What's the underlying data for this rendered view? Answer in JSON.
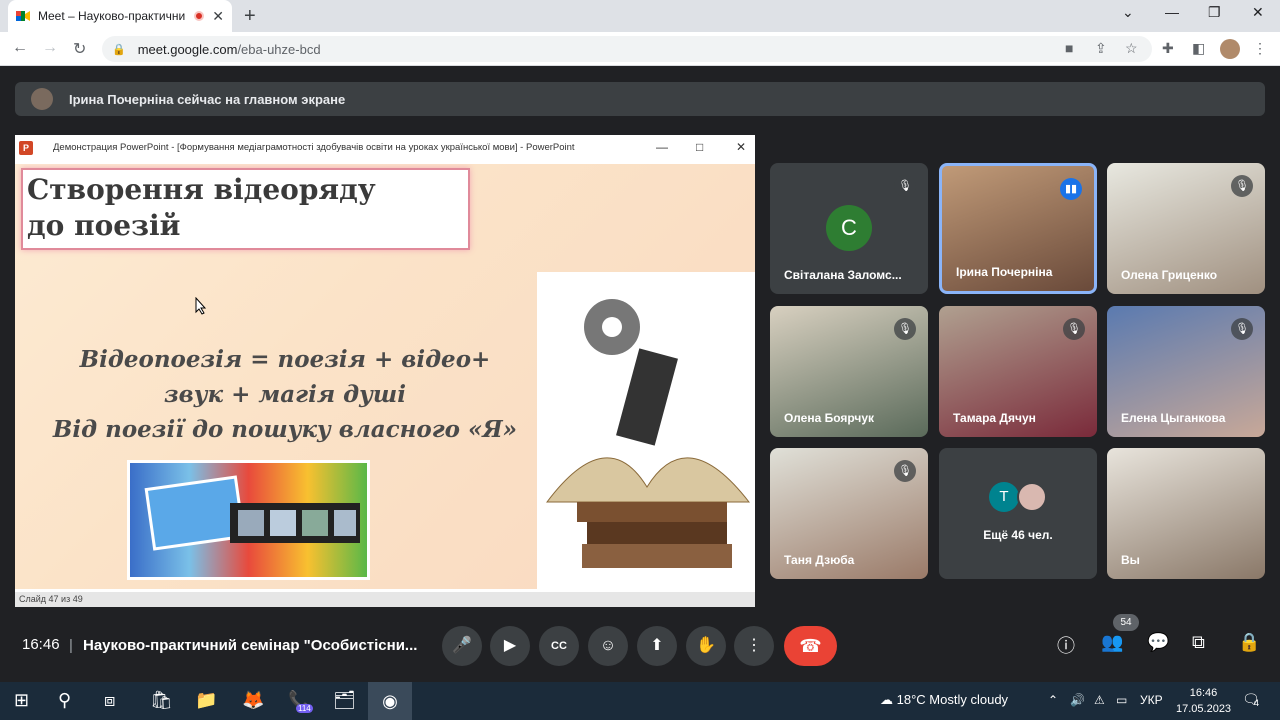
{
  "browser": {
    "tab_title": "Meet – Науково-практичний",
    "tab_close": "✕",
    "new_tab": "+",
    "url_host": "meet.google.com",
    "url_path": "/eba-uhze-bcd",
    "window_min": "⌄",
    "window_restore": "❐",
    "window_close": "✕",
    "window_extra": "—"
  },
  "meet": {
    "banner_text": "Ірина Почерніна сейчас на главном экране",
    "presentation": {
      "window_title": "Демонстрация PowerPoint - [Формування медіаграмотності здобувачів освіти на уроках української мови] - PowerPoint",
      "slide_title_line1": "Створення відеоряду",
      "slide_title_line2": "до поезій",
      "slide_body_line1": "Відеопоезія = поезія + відео+",
      "slide_body_line2": "звук + магія душі",
      "slide_body_line3": "Від  поезії до пошуку власного «Я»",
      "status": "Слайд 47 из 49"
    },
    "participants": [
      {
        "name": "Світалана Заломс...",
        "initial": "C"
      },
      {
        "name": "Ірина Почерніна"
      },
      {
        "name": "Олена Гриценко"
      },
      {
        "name": "Олена Боярчук"
      },
      {
        "name": "Тамара Дячун"
      },
      {
        "name": "Елена Цыганкова"
      },
      {
        "name": "Таня Дзюба"
      },
      {
        "name": "Ещё 46 чел.",
        "initial": "T"
      },
      {
        "name": "Вы"
      }
    ],
    "clock": "16:46",
    "separator": "|",
    "meeting_title": "Науково-практичний семінар \"Особистісни...",
    "people_count": "54"
  },
  "taskbar": {
    "temperature": "18°C",
    "weather": "Mostly cloudy",
    "language": "УКР",
    "time": "16:46",
    "date": "17.05.2023",
    "viber_badge": "114",
    "notifications": "4"
  },
  "colors": {
    "meet_bg": "#202124",
    "end_call": "#ea4335",
    "speaking": "#1a73e8"
  }
}
